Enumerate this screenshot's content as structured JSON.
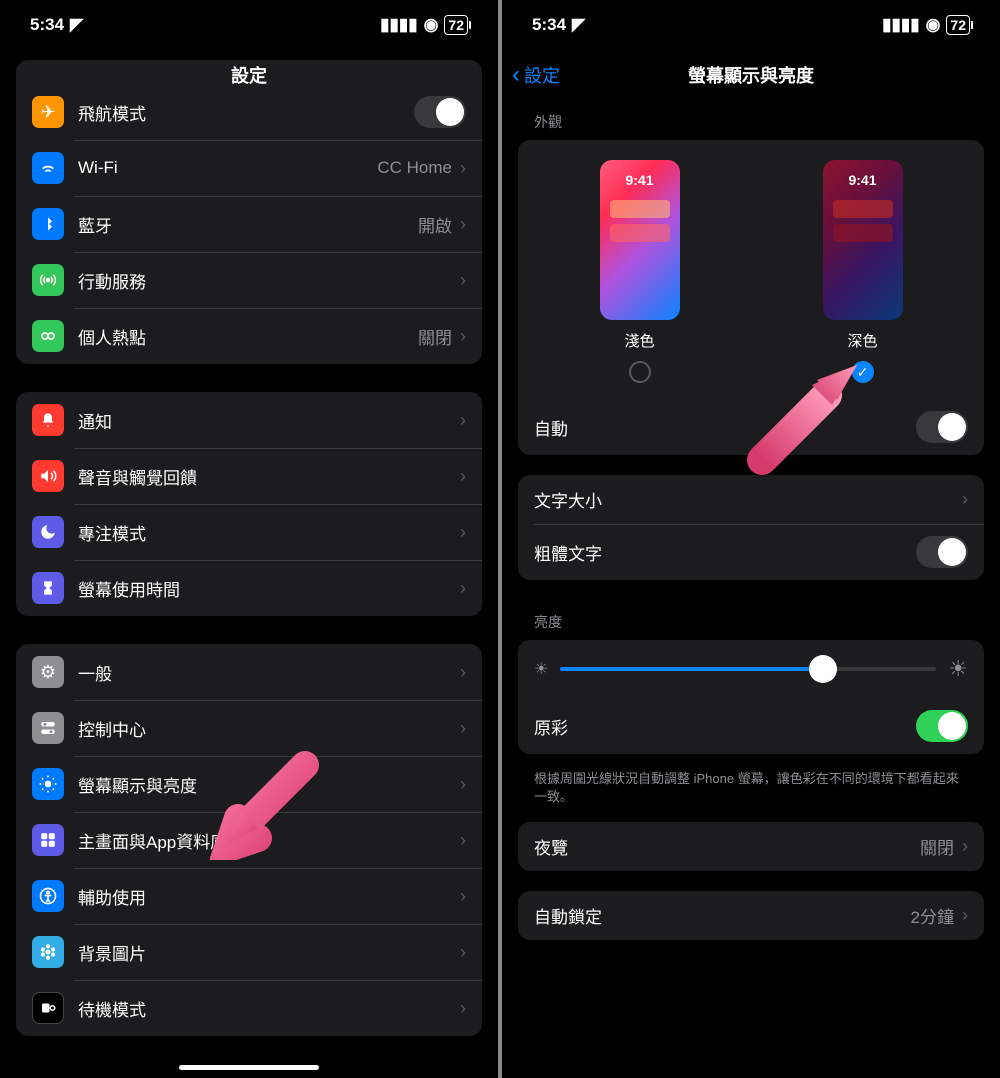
{
  "status": {
    "time": "5:34",
    "battery": "72"
  },
  "left": {
    "title": "設定",
    "groups": [
      {
        "type": "network",
        "rows": [
          {
            "icon": "airplane-icon",
            "bg": "bg-orange",
            "glyph": "✈",
            "label": "飛航模式",
            "kind": "toggle",
            "on": false
          },
          {
            "icon": "wifi-icon",
            "bg": "bg-blue",
            "glyph": "◉",
            "label": "Wi-Fi",
            "kind": "link",
            "value": "CC Home"
          },
          {
            "icon": "bluetooth-icon",
            "bg": "bg-blue",
            "glyph": "⌖",
            "label": "藍牙",
            "kind": "link",
            "value": "開啟"
          },
          {
            "icon": "cellular-icon",
            "bg": "bg-green",
            "glyph": "⍑",
            "label": "行動服務",
            "kind": "link"
          },
          {
            "icon": "hotspot-icon",
            "bg": "bg-green",
            "glyph": "⊕",
            "label": "個人熱點",
            "kind": "link",
            "value": "關閉"
          }
        ]
      },
      {
        "type": "notifications",
        "rows": [
          {
            "icon": "notifications-icon",
            "bg": "bg-red",
            "glyph": "◼",
            "label": "通知",
            "kind": "link"
          },
          {
            "icon": "sounds-icon",
            "bg": "bg-red",
            "glyph": "◀))",
            "label": "聲音與觸覺回饋",
            "kind": "link"
          },
          {
            "icon": "focus-icon",
            "bg": "bg-indigo",
            "glyph": "☾",
            "label": "專注模式",
            "kind": "link"
          },
          {
            "icon": "screentime-icon",
            "bg": "bg-indigo",
            "glyph": "⧗",
            "label": "螢幕使用時間",
            "kind": "link"
          }
        ]
      },
      {
        "type": "general",
        "rows": [
          {
            "icon": "general-icon",
            "bg": "bg-gray",
            "glyph": "⚙",
            "label": "一般",
            "kind": "link"
          },
          {
            "icon": "control-center-icon",
            "bg": "bg-gray",
            "glyph": "⌥",
            "label": "控制中心",
            "kind": "link"
          },
          {
            "icon": "display-icon",
            "bg": "bg-blue",
            "glyph": "☀",
            "label": "螢幕顯示與亮度",
            "kind": "link"
          },
          {
            "icon": "homescreen-icon",
            "bg": "bg-indigo",
            "glyph": "▦",
            "label": "主畫面與App資料庫",
            "kind": "link"
          },
          {
            "icon": "accessibility-icon",
            "bg": "bg-blue",
            "glyph": "⊕",
            "label": "輔助使用",
            "kind": "link"
          },
          {
            "icon": "wallpaper-icon",
            "bg": "bg-cyan",
            "glyph": "❀",
            "label": "背景圖片",
            "kind": "link"
          },
          {
            "icon": "standby-icon",
            "bg": "bg-black",
            "glyph": "◐",
            "label": "待機模式",
            "kind": "link"
          }
        ]
      }
    ]
  },
  "right": {
    "back": "設定",
    "title": "螢幕顯示與亮度",
    "appearance": {
      "header": "外觀",
      "light_label": "淺色",
      "dark_label": "深色",
      "preview_time": "9:41",
      "selected": "dark",
      "auto_label": "自動",
      "auto_on": false
    },
    "text": {
      "text_size_label": "文字大小",
      "bold_label": "粗體文字",
      "bold_on": false
    },
    "brightness": {
      "header": "亮度",
      "value_pct": 70,
      "true_tone_label": "原彩",
      "true_tone_on": true,
      "desc": "根據周圍光線狀況自動調整 iPhone 螢幕，讓色彩在不同的環境下都看起來一致。"
    },
    "night_shift": {
      "label": "夜覽",
      "value": "關閉"
    },
    "auto_lock": {
      "label": "自動鎖定",
      "value": "2分鐘"
    }
  }
}
